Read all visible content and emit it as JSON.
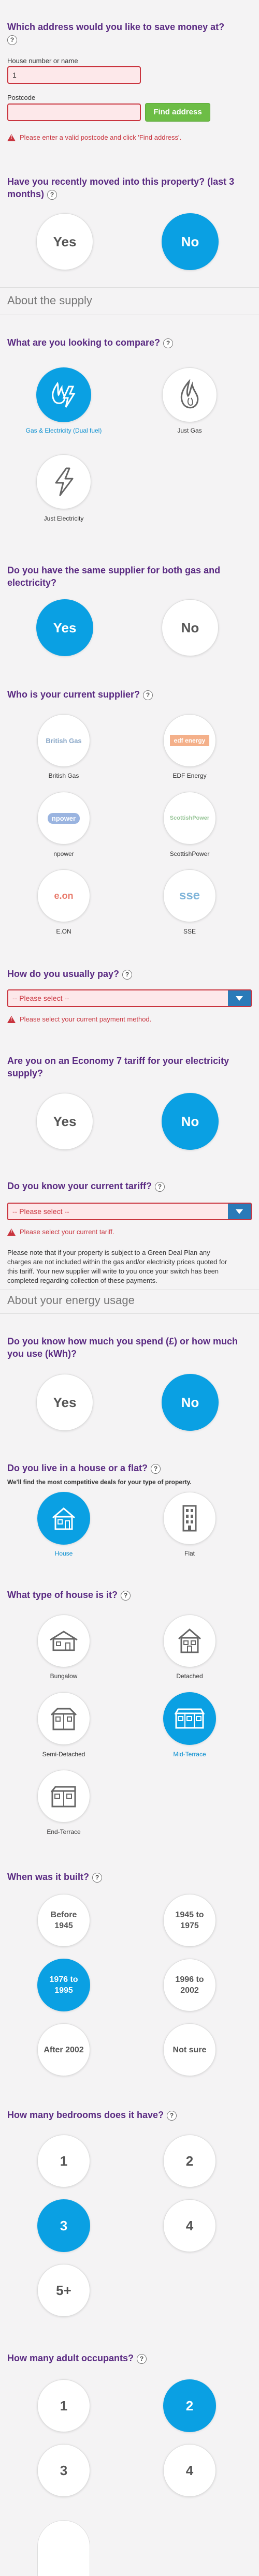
{
  "address": {
    "question": "Which address would you like to save money at?",
    "house_label": "House number or name",
    "house_value": "1",
    "postcode_label": "Postcode",
    "postcode_value": "",
    "find_button": "Find address",
    "error": "Please enter a valid postcode and click 'Find address'."
  },
  "moved": {
    "question": "Have you recently moved into this property? (last 3 months)",
    "options": [
      "Yes",
      "No"
    ],
    "selected": "No"
  },
  "supply_header": "About the supply",
  "compare": {
    "question": "What are you looking to compare?",
    "options": [
      {
        "label": "Gas & Electricity (Dual fuel)",
        "icon": "dual-fuel-icon",
        "selected": true
      },
      {
        "label": "Just Gas",
        "icon": "gas-flame-icon",
        "selected": false
      },
      {
        "label": "Just Electricity",
        "icon": "electricity-bolt-icon",
        "selected": false
      }
    ]
  },
  "same_supplier": {
    "question": "Do you have the same supplier for both gas and electricity?",
    "options": [
      "Yes",
      "No"
    ],
    "selected": "Yes"
  },
  "current_supplier": {
    "question": "Who is your current supplier?",
    "options": [
      {
        "label": "British Gas",
        "logo": "British Gas"
      },
      {
        "label": "EDF Energy",
        "logo": "edf energy"
      },
      {
        "label": "npower",
        "logo": "npower"
      },
      {
        "label": "ScottishPower",
        "logo": "ScottishPower"
      },
      {
        "label": "E.ON",
        "logo": "e.on"
      },
      {
        "label": "SSE",
        "logo": "sse"
      }
    ]
  },
  "pay": {
    "question": "How do you usually pay?",
    "placeholder": "-- Please select --",
    "error": "Please select your current payment method."
  },
  "economy7": {
    "question": "Are you on an Economy 7 tariff for your electricity supply?",
    "options": [
      "Yes",
      "No"
    ],
    "selected": "No"
  },
  "tariff": {
    "question": "Do you know your current tariff?",
    "placeholder": "-- Please select --",
    "error": "Please select your current tariff.",
    "note": "Please note that if your property is subject to a Green Deal Plan any charges are not included within the gas and/or electricity prices quoted for this tariff. Your new supplier will write to you once your switch has been completed regarding collection of these payments."
  },
  "usage_header": "About your energy usage",
  "know_spend": {
    "question": "Do you know how much you spend (£) or how much you use (kWh)?",
    "options": [
      "Yes",
      "No"
    ],
    "selected": "No"
  },
  "house_or_flat": {
    "question": "Do you live in a house or a flat?",
    "sub": "We'll find the most competitive deals for your type of property.",
    "options": [
      {
        "label": "House",
        "selected": true
      },
      {
        "label": "Flat",
        "selected": false
      }
    ]
  },
  "house_type": {
    "question": "What type of house is it?",
    "options": [
      {
        "label": "Bungalow",
        "selected": false
      },
      {
        "label": "Detached",
        "selected": false
      },
      {
        "label": "Semi-Detached",
        "selected": false
      },
      {
        "label": "Mid-Terrace",
        "selected": true
      },
      {
        "label": "End-Terrace",
        "selected": false
      }
    ]
  },
  "built": {
    "question": "When was it built?",
    "options": [
      {
        "l1": "Before",
        "l2": "1945",
        "selected": false
      },
      {
        "l1": "1945 to",
        "l2": "1975",
        "selected": false
      },
      {
        "l1": "1976 to",
        "l2": "1995",
        "selected": true
      },
      {
        "l1": "1996 to",
        "l2": "2002",
        "selected": false
      },
      {
        "l1": "After 2002",
        "l2": "",
        "selected": false
      },
      {
        "l1": "Not sure",
        "l2": "",
        "selected": false
      }
    ]
  },
  "bedrooms": {
    "question": "How many bedrooms does it have?",
    "options": [
      "1",
      "2",
      "3",
      "4",
      "5+"
    ],
    "selected": "3"
  },
  "occupants": {
    "question": "How many adult occupants?",
    "options": [
      "1",
      "2",
      "3",
      "4"
    ],
    "selected": "2"
  },
  "colors": {
    "accent": "#0aa0e3",
    "heading": "#5a2a82",
    "error": "#c9343e",
    "find_button": "#6dbd46"
  }
}
